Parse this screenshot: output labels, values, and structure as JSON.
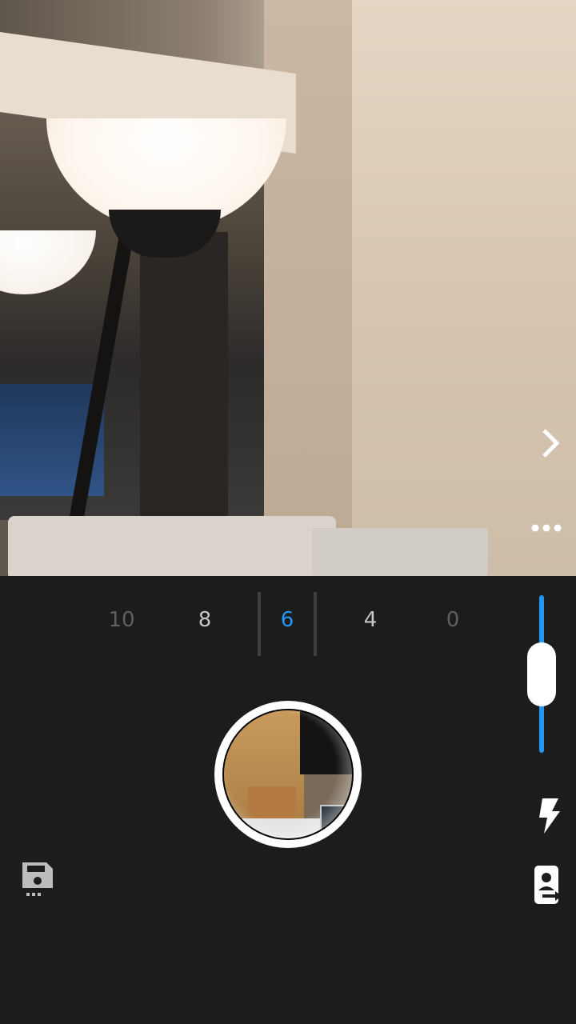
{
  "camera": {
    "zoom": {
      "options": [
        "10",
        "8",
        "6",
        "4",
        "0"
      ],
      "selected": "6",
      "colors": {
        "inactive": "#5e6060",
        "active": "#2196f3",
        "near": "#c5c5c5"
      }
    },
    "exposure_slider": {
      "level": 0.3,
      "track_color": "#2196f3"
    },
    "icons": {
      "next": "chevron-right-icon",
      "more": "more-dots-icon",
      "flash": "flash-icon",
      "switch": "switch-camera-icon",
      "save": "save-storage-icon"
    }
  }
}
